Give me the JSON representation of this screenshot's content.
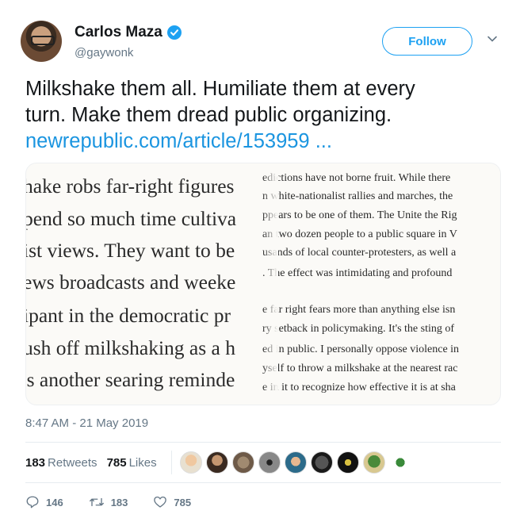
{
  "author": {
    "name": "Carlos Maza",
    "handle": "@gaywonk",
    "verified": true
  },
  "follow_button": {
    "label": "Follow"
  },
  "tweet": {
    "text_line1": "Milkshake them all. Humiliate them at every",
    "text_line2": "turn. Make them dread public organizing.",
    "link": "newrepublic.com/article/153959 ..."
  },
  "media": {
    "left_column": [
      "hake robs far-right figures",
      "pend so much time cultiva",
      "ist views. They want to be",
      "ews broadcasts and weeke",
      "ipant in the democratic pr",
      "ush off milkshaking as a h",
      "'s another searing reminde"
    ],
    "right_column": [
      "edictions have not borne fruit. While there",
      "n white-nationalist rallies and marches, the",
      "ppears to be one of them. The Unite the Rig",
      "an two dozen people to a public square in V",
      "usands of local counter-protesters, as well a",
      ". The effect was intimidating and profound",
      "e far right fears more than anything else isn",
      "ry setback in policymaking. It's the sting of",
      "ed in public. I personally oppose violence in",
      "yself to throw a milkshake at the nearest rac",
      "e in it to recognize how effective it is at sha"
    ]
  },
  "timestamp": "8:47 AM - 21 May 2019",
  "stats": {
    "retweets_count": "183",
    "retweets_label": "Retweets",
    "likes_count": "785",
    "likes_label": "Likes"
  },
  "actions": {
    "reply_count": "146",
    "retweet_count": "183",
    "like_count": "785"
  },
  "colors": {
    "accent": "#1da1f2",
    "link": "#1b95e0",
    "muted": "#657786",
    "text": "#14171a"
  },
  "icons": [
    "verified-badge-icon",
    "chevron-down-icon",
    "reply-icon",
    "retweet-icon",
    "heart-icon"
  ]
}
